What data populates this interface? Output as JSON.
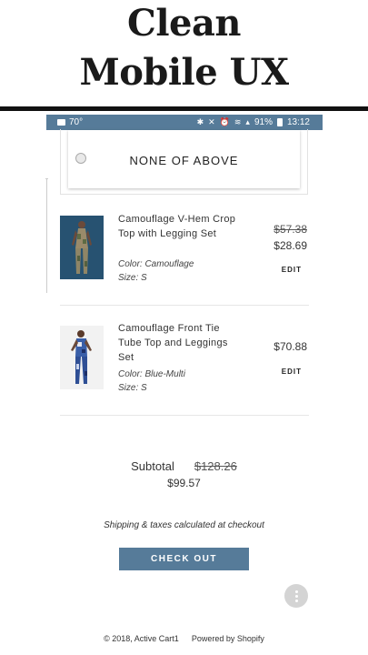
{
  "headline": {
    "line1": "Clean",
    "line2": "Mobile UX"
  },
  "status_bar": {
    "temperature": "70°",
    "battery_percent": "91%",
    "time": "13:12",
    "background_color": "#567b99"
  },
  "option": {
    "label": "NONE OF ABOVE"
  },
  "cart": {
    "items": [
      {
        "title": "Camouflage V-Hem Crop Top with Legging Set",
        "color_text": "Color: Camouflage",
        "size_text": "Size: S",
        "original_price": "$57.38",
        "price": "$28.69",
        "edit_label": "EDIT"
      },
      {
        "title": "Camouflage Front Tie Tube Top and Leggings Set",
        "color_text": "Color: Blue-Multi",
        "size_text": "Size: S",
        "price": "$70.88",
        "edit_label": "EDIT"
      }
    ],
    "subtotal_label": "Subtotal",
    "subtotal_original": "$128.26",
    "subtotal": "$99.57",
    "shipping_note": "Shipping & taxes calculated at checkout",
    "checkout_label": "CHECK OUT"
  },
  "footer": {
    "copyright": "© 2018, Active Cart1",
    "powered_by": "Powered by Shopify"
  },
  "colors": {
    "accent": "#567b99",
    "fab": "#d4d4d4"
  }
}
